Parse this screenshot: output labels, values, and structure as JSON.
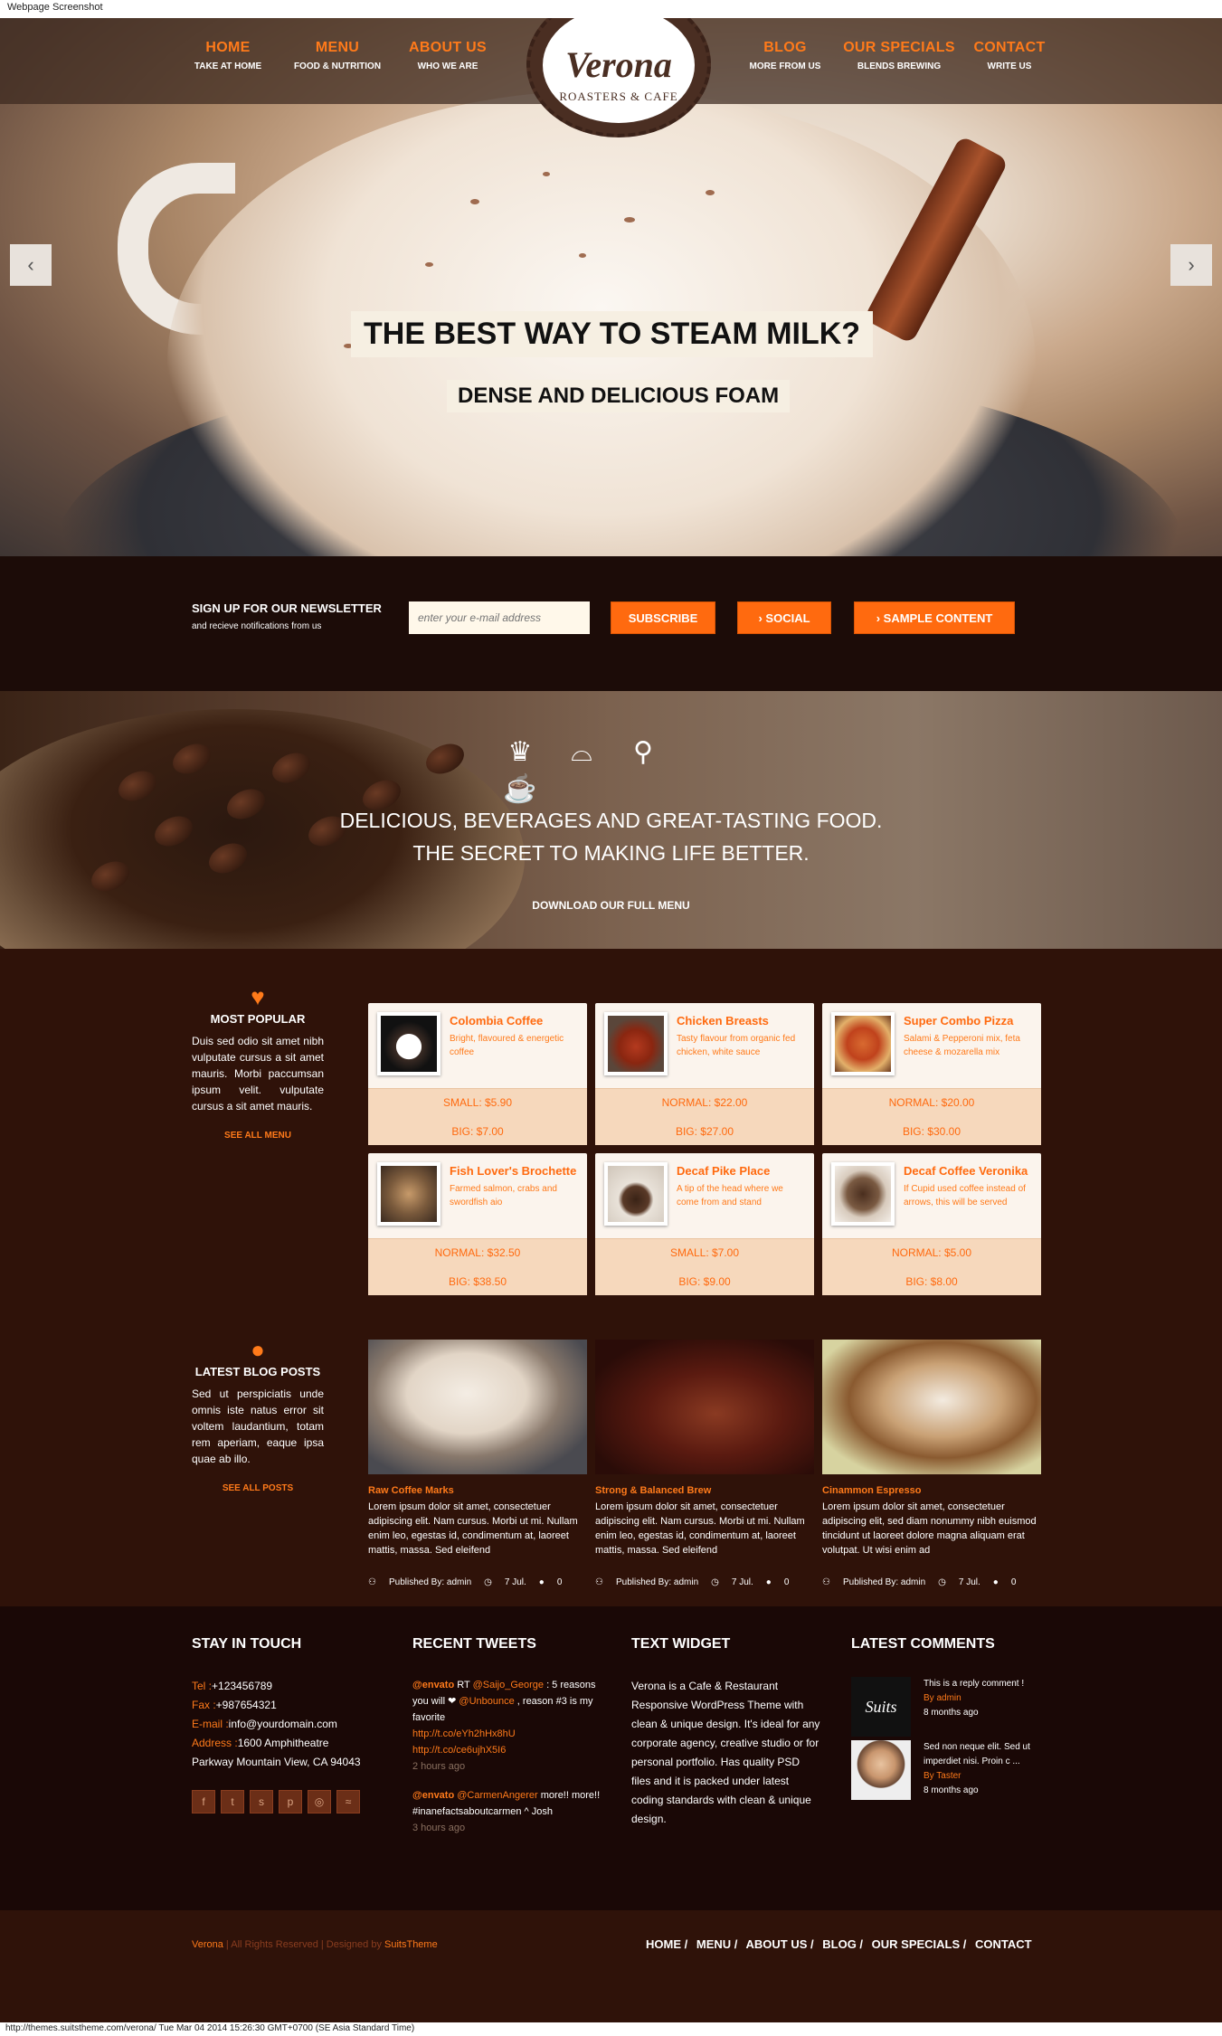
{
  "caption": "Webpage Screenshot",
  "nav_left": [
    {
      "label": "HOME",
      "sub": "TAKE AT HOME"
    },
    {
      "label": "MENU",
      "sub": "FOOD & NUTRITION"
    },
    {
      "label": "ABOUT US",
      "sub": "WHO WE ARE"
    }
  ],
  "nav_right": [
    {
      "label": "BLOG",
      "sub": "MORE FROM US"
    },
    {
      "label": "OUR SPECIALS",
      "sub": "BLENDS BREWING"
    },
    {
      "label": "CONTACT",
      "sub": "WRITE US"
    }
  ],
  "logo": {
    "name": "Verona",
    "sub": "ROASTERS & CAFE"
  },
  "hero": {
    "headline": "THE BEST WAY TO STEAM MILK?",
    "subline": "DENSE AND DELICIOUS FOAM",
    "prev": "‹",
    "next": "›"
  },
  "newsletter": {
    "title": "SIGN UP FOR OUR NEWSLETTER",
    "subtitle": "and recieve notifications from us",
    "placeholder": "enter your e-mail address",
    "subscribe": "SUBSCRIBE",
    "social": "› SOCIAL",
    "sample": "› SAMPLE CONTENT"
  },
  "beans": {
    "line1": "DELICIOUS, BEVERAGES AND GREAT-TASTING FOOD.",
    "line2": "THE SECRET TO MAKING LIFE BETTER.",
    "download": "DOWNLOAD OUR FULL MENU"
  },
  "popular": {
    "title": "MOST POPULAR",
    "text": "Duis sed odio sit amet nibh vulputate cursus a sit amet mauris. Morbi paccumsan ipsum velit. vulputate cursus a sit amet mauris.",
    "link": "SEE ALL MENU"
  },
  "menu": [
    {
      "name": "Colombia Coffee",
      "desc": "Bright, flavoured & energetic coffee",
      "p1": "SMALL: $5.90",
      "p2": "BIG: $7.00"
    },
    {
      "name": "Chicken Breasts",
      "desc": "Tasty flavour from organic fed chicken, white sauce",
      "p1": "NORMAL: $22.00",
      "p2": "BIG: $27.00"
    },
    {
      "name": "Super Combo Pizza",
      "desc": "Salami & Pepperoni mix, feta cheese & mozarella mix",
      "p1": "NORMAL: $20.00",
      "p2": "BIG: $30.00"
    },
    {
      "name": "Fish Lover's Brochette",
      "desc": "Farmed salmon, crabs and swordfish aio",
      "p1": "NORMAL: $32.50",
      "p2": "BIG: $38.50"
    },
    {
      "name": "Decaf Pike Place",
      "desc": "A tip of the head where we come from and stand",
      "p1": "SMALL: $7.00",
      "p2": "BIG: $9.00"
    },
    {
      "name": "Decaf Coffee Veronika",
      "desc": "If Cupid used coffee instead of arrows, this will be served",
      "p1": "NORMAL: $5.00",
      "p2": "BIG: $8.00"
    }
  ],
  "blogside": {
    "title": "LATEST BLOG POSTS",
    "text": "Sed ut perspiciatis unde omnis iste natus error sit voltem laudantium, totam rem aperiam, eaque ipsa quae ab illo.",
    "link": "SEE ALL POSTS"
  },
  "posts": [
    {
      "title": "Raw Coffee Marks",
      "text": "Lorem ipsum dolor sit amet, consectetuer adipiscing elit. Nam cursus. Morbi ut mi. Nullam enim leo, egestas id, condimentum at, laoreet mattis, massa. Sed eleifend",
      "author": "Published By: admin",
      "date": "7 Jul.",
      "comments": "0"
    },
    {
      "title": "Strong & Balanced Brew",
      "text": "Lorem ipsum dolor sit amet, consectetuer adipiscing elit. Nam cursus. Morbi ut mi. Nullam enim leo, egestas id, condimentum at, laoreet mattis, massa. Sed eleifend",
      "author": "Published By: admin",
      "date": "7 Jul.",
      "comments": "0"
    },
    {
      "title": "Cinammon Espresso",
      "text": "Lorem ipsum dolor sit amet, consectetuer adipiscing elit, sed diam nonummy nibh euismod tincidunt ut laoreet dolore magna aliquam erat volutpat. Ut wisi enim ad",
      "author": "Published By: admin",
      "date": "7 Jul.",
      "comments": "0"
    }
  ],
  "touch": {
    "title": "STAY IN TOUCH",
    "tel_l": "Tel :",
    "tel": "+123456789",
    "fax_l": "Fax :",
    "fax": "+987654321",
    "email_l": "E-mail :",
    "email": "info@yourdomain.com",
    "addr_l": "Address :",
    "addr1": "1600 Amphitheatre",
    "addr2": "Parkway Mountain View, CA 94043"
  },
  "tweets": {
    "title": "RECENT TWEETS",
    "t1a": "@envato",
    "t1b": " RT ",
    "t1c": "@Saijo_George",
    "t1d": " : 5 reasons you will ❤ ",
    "t1e": "@Unbounce",
    "t1f": " , reason #3 is my favorite",
    "t1g": "http://t.co/eYh2hHx8hU",
    "t1h": "http://t.co/ce6ujhX5I6",
    "t1ago": "2 hours ago",
    "t2a": "@envato",
    "t2b": " ",
    "t2c": "@CarmenAngerer",
    "t2d": " more!! more!! #inanefactsaboutcarmen ^ Josh",
    "t2ago": "3 hours ago"
  },
  "textwidget": {
    "title": "TEXT WIDGET",
    "text": "Verona is a Cafe & Restaurant Responsive WordPress Theme with clean & unique design. It's ideal for any corporate agency, creative studio or for personal portfolio. Has quality PSD files and it is packed under latest coding standards with clean & unique design."
  },
  "comments": {
    "title": "LATEST COMMENTS",
    "c1": "This is a reply comment !",
    "c1by": "By admin",
    "c1ago": "8 months ago",
    "c1logo": "Suits",
    "c2": "Sed non neque elit. Sed ut imperdiet nisi. Proin c ...",
    "c2by": "By Taster",
    "c2ago": "8 months ago"
  },
  "footerbar": {
    "brand": "Verona",
    "rights": " | All Rights Reserved | Designed by ",
    "designer": "SuitsTheme",
    "links": [
      "HOME /",
      "MENU /",
      "ABOUT US /",
      "BLOG /",
      "OUR SPECIALS /",
      "CONTACT"
    ]
  },
  "status": "http://themes.suitstheme.com/verona/ Tue Mar 04 2014 15:26:30 GMT+0700 (SE Asia Standard Time)",
  "colors": {
    "accent": "#ff6a0f",
    "dark": "#1c0c08",
    "brown": "#2f1209"
  }
}
